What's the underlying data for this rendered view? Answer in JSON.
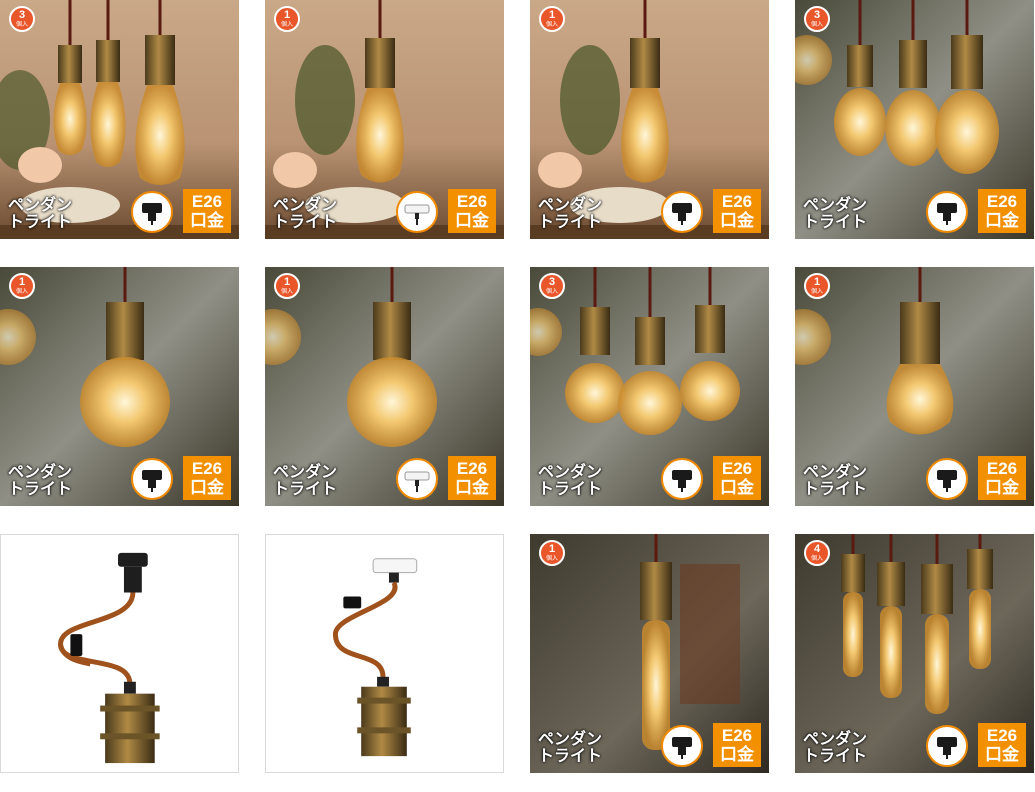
{
  "colors": {
    "badge": "#e8562a",
    "e26_box": "#f29000",
    "adapter_ring": "#f08a00"
  },
  "tiles": [
    {
      "badge_count": "3",
      "badge_unit": "個入",
      "label_line1": "ペンダン",
      "label_line2": "トライト",
      "adapter": "black-rail-adapter-icon",
      "e26_line1": "E26",
      "e26_line2": "口金"
    },
    {
      "badge_count": "1",
      "badge_unit": "個入",
      "label_line1": "ペンダン",
      "label_line2": "トライト",
      "adapter": "white-ceiling-adapter-icon",
      "e26_line1": "E26",
      "e26_line2": "口金"
    },
    {
      "badge_count": "1",
      "badge_unit": "個入",
      "label_line1": "ペンダン",
      "label_line2": "トライト",
      "adapter": "black-rail-adapter-icon",
      "e26_line1": "E26",
      "e26_line2": "口金"
    },
    {
      "badge_count": "3",
      "badge_unit": "個入",
      "label_line1": "ペンダン",
      "label_line2": "トライト",
      "adapter": "black-rail-adapter-icon",
      "e26_line1": "E26",
      "e26_line2": "口金"
    },
    {
      "badge_count": "1",
      "badge_unit": "個入",
      "label_line1": "ペンダン",
      "label_line2": "トライト",
      "adapter": "black-rail-adapter-icon",
      "e26_line1": "E26",
      "e26_line2": "口金"
    },
    {
      "badge_count": "1",
      "badge_unit": "個入",
      "label_line1": "ペンダン",
      "label_line2": "トライト",
      "adapter": "white-ceiling-adapter-icon",
      "e26_line1": "E26",
      "e26_line2": "口金"
    },
    {
      "badge_count": "3",
      "badge_unit": "個入",
      "label_line1": "ペンダン",
      "label_line2": "トライト",
      "adapter": "black-rail-adapter-icon",
      "e26_line1": "E26",
      "e26_line2": "口金"
    },
    {
      "badge_count": "1",
      "badge_unit": "個入",
      "label_line1": "ペンダン",
      "label_line2": "トライト",
      "adapter": "black-rail-adapter-icon",
      "e26_line1": "E26",
      "e26_line2": "口金"
    },
    {
      "product": "black-rail-pendant-cord"
    },
    {
      "product": "white-ceiling-pendant-cord"
    },
    {
      "badge_count": "1",
      "badge_unit": "個入",
      "label_line1": "ペンダン",
      "label_line2": "トライト",
      "adapter": "black-rail-adapter-icon",
      "e26_line1": "E26",
      "e26_line2": "口金"
    },
    {
      "badge_count": "4",
      "badge_unit": "個入",
      "label_line1": "ペンダン",
      "label_line2": "トライト",
      "adapter": "black-rail-adapter-icon",
      "e26_line1": "E26",
      "e26_line2": "口金"
    }
  ]
}
